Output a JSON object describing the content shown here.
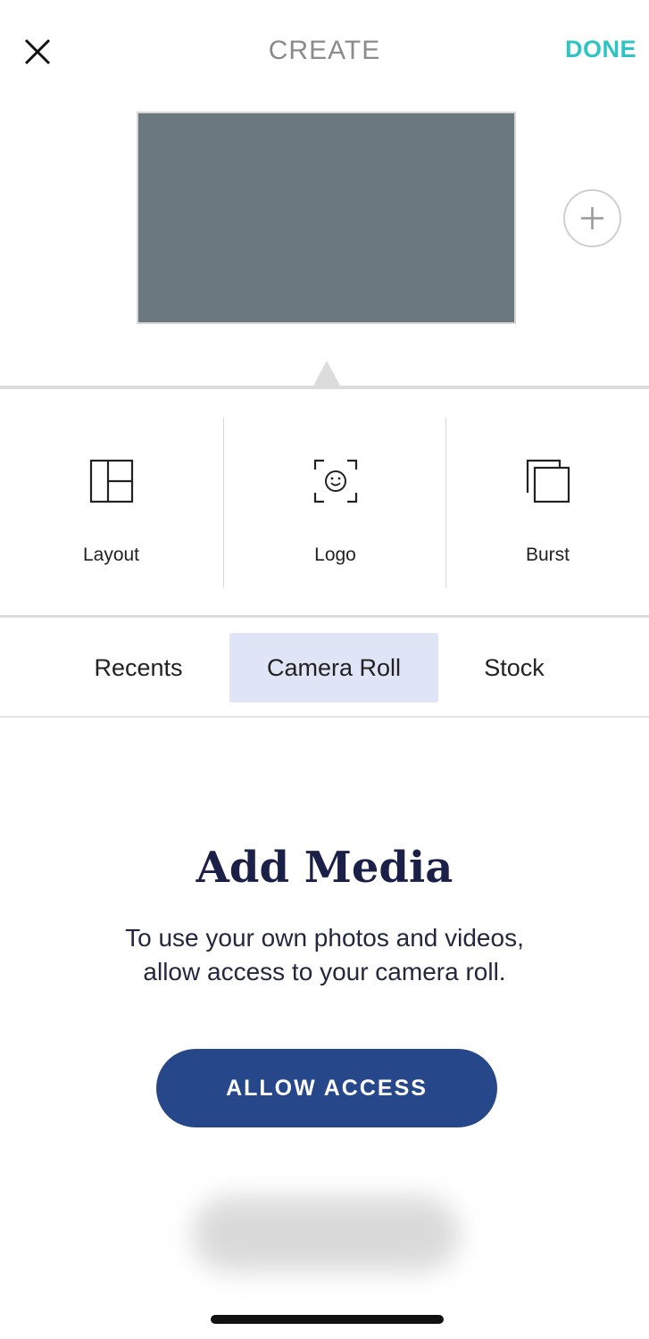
{
  "header": {
    "title": "CREATE",
    "done_label": "DONE"
  },
  "preview": {
    "canvas_color": "#6a7880"
  },
  "tools": [
    {
      "label": "Layout",
      "icon": "layout-grid-icon"
    },
    {
      "label": "Logo",
      "icon": "logo-face-icon"
    },
    {
      "label": "Burst",
      "icon": "burst-stack-icon"
    }
  ],
  "tabs": [
    {
      "label": "Recents",
      "active": false
    },
    {
      "label": "Camera Roll",
      "active": true
    },
    {
      "label": "Stock",
      "active": false
    }
  ],
  "media": {
    "heading": "Add Media",
    "line1": "To use your own photos and videos,",
    "line2": "allow access to your camera roll.",
    "button_label": "ALLOW ACCESS"
  },
  "colors": {
    "accent": "#2ec4c4",
    "button": "#26478a",
    "heading": "#1b2048",
    "active_tab": "#dfe4f6"
  }
}
